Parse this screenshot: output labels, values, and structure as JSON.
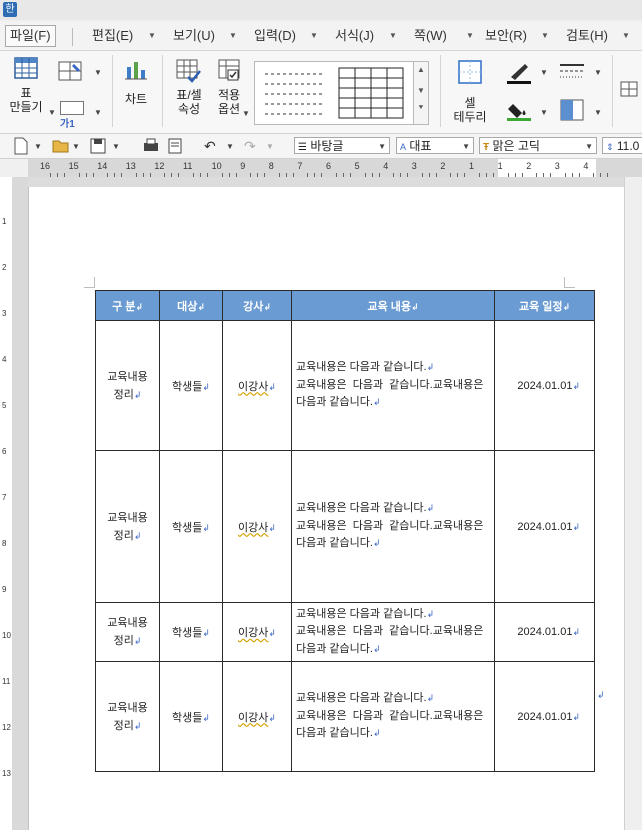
{
  "app": {
    "icon_glyph": "한"
  },
  "menu": {
    "items": [
      {
        "label": "파일(F)",
        "active": true
      },
      {
        "label": "편집(E)"
      },
      {
        "label": "보기(U)"
      },
      {
        "label": "입력(D)"
      },
      {
        "label": "서식(J)"
      },
      {
        "label": "쪽(W)"
      },
      {
        "label": "보안(R)"
      },
      {
        "label": "검토(H)"
      }
    ]
  },
  "ribbon": {
    "table_make": "표\n만들기",
    "cell_style_sample": "가1",
    "chart": "차트",
    "table_props": "표/셀\n속성",
    "apply_options": "적용\n옵션",
    "cell_border": "셀\n테두리"
  },
  "format_toolbar": {
    "style": "바탕글",
    "lang": "대표",
    "font": "맑은 고딕",
    "size": "11.0"
  },
  "ruler": {
    "labels": [
      "16",
      "15",
      "14",
      "13",
      "12",
      "11",
      "10",
      "9",
      "8",
      "7",
      "6",
      "5",
      "4",
      "3",
      "2",
      "1",
      "1",
      "2",
      "3",
      "4"
    ],
    "vlabels": [
      "1",
      "2",
      "3",
      "4",
      "5",
      "6",
      "7",
      "8",
      "9",
      "10",
      "11",
      "12",
      "13"
    ]
  },
  "table": {
    "headers": [
      "구  분",
      "대상",
      "강사",
      "교육 내용",
      "교육 일정"
    ],
    "paragraph_mark": "↲",
    "rows": [
      {
        "category": "교육내용\n정리",
        "target": "학생들",
        "instructor": "이강사",
        "content_line1": "교육내용은 다음과 같습니다.",
        "content_line2": "교육내용은  다음과  같습니다.교육내용은",
        "content_line3": "다음과 같습니다.",
        "date": "2024.01.01"
      },
      {
        "category": "교육내용\n정리",
        "target": "학생들",
        "instructor": "이강사",
        "content_line1": "교육내용은 다음과 같습니다.",
        "content_line2": "교육내용은  다음과  같습니다.교육내용은",
        "content_line3": "다음과 같습니다.",
        "date": "2024.01.01"
      },
      {
        "category": "교육내용\n정리",
        "target": "학생들",
        "instructor": "이강사",
        "content_line1": "교육내용은 다음과 같습니다.",
        "content_line2": "교육내용은  다음과  같습니다.교육내용은",
        "content_line3": "다음과 같습니다.",
        "date": "2024.01.01"
      },
      {
        "category": "교육내용\n정리",
        "target": "학생들",
        "instructor": "이강사",
        "content_line1": "교육내용은 다음과 같습니다.",
        "content_line2": "교육내용은  다음과  같습니다.교육내용은",
        "content_line3": "다음과 같습니다.",
        "date": "2024.01.01"
      }
    ]
  },
  "colors": {
    "header_bg": "#6a9bd2",
    "paragraph_mark": "#3a66c4"
  }
}
